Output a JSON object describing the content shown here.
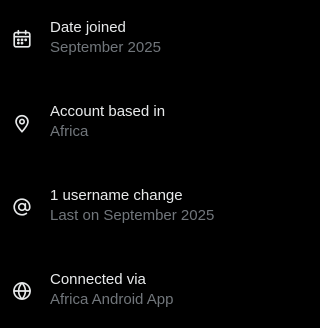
{
  "colors": {
    "background": "#000000",
    "title_text": "#e7e9ea",
    "subtitle_text": "#71767b",
    "icon": "#e7e9ea"
  },
  "items": [
    {
      "icon": "calendar-icon",
      "title": "Date joined",
      "subtitle": "September 2025"
    },
    {
      "icon": "location-pin-icon",
      "title": "Account based in",
      "subtitle": "Africa"
    },
    {
      "icon": "at-sign-icon",
      "title": "1 username change",
      "subtitle": "Last on September 2025"
    },
    {
      "icon": "globe-icon",
      "title": "Connected via",
      "subtitle": "Africa Android App"
    }
  ]
}
